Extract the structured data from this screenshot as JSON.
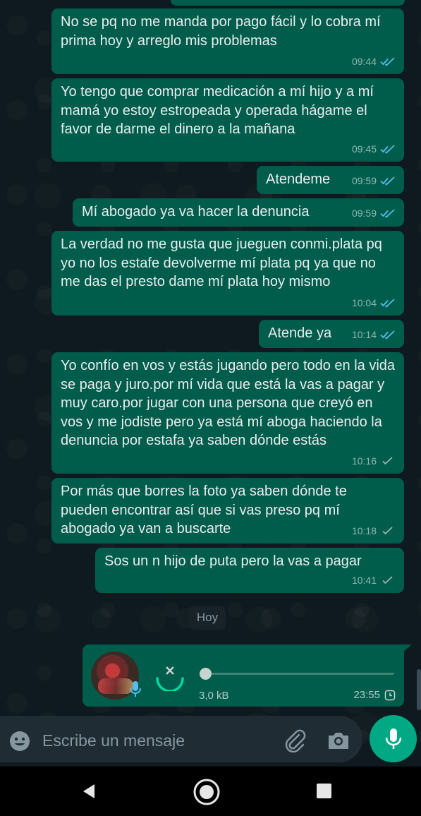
{
  "messages": [
    {
      "text": "No se pq no me manda por pago fácil y lo cobra mí prima hoy y arreglo mis problemas",
      "time": "09:44",
      "status": "read-double-check-blue"
    },
    {
      "text": "Yo tengo que comprar medicación a mí hijo y a mí mamá yo estoy estropeada y operada hágame el favor de darme el dinero a la mañana",
      "time": "09:45",
      "status": "read-double-check-blue"
    },
    {
      "text": "Atendeme",
      "time": "09:59",
      "status": "read-double-check-blue"
    },
    {
      "text": "Mí abogado ya va hacer la denuncia",
      "time": "09:59",
      "status": "read-double-check-blue"
    },
    {
      "text": "La verdad no me gusta que jueguen conmi.plata pq yo no los estafe devolverme mí plata pq ya que no me das el presto dame mí plata hoy mismo",
      "time": "10:04",
      "status": "read-double-check-blue"
    },
    {
      "text": "Atende ya",
      "time": "10:14",
      "status": "read-double-check-blue"
    },
    {
      "text": "Yo confío en vos y estás jugando pero todo en la vida se paga y juro.por mí vida que está la vas a pagar y muy caro.por jugar con una persona que creyó en vos y me jodiste pero ya está mí aboga haciendo la denuncia por estafa ya saben dónde estás",
      "time": "10:16",
      "status": "sent-single-check"
    },
    {
      "text": "Por más que borres la foto ya saben dónde te pueden encontrar así que si vas preso pq mí abogado ya van a buscarte",
      "time": "10:18",
      "status": "sent-single-check"
    },
    {
      "text": "Sos un n hijo de puta pero la vas a pagar",
      "time": "10:41",
      "status": "sent-single-check"
    }
  ],
  "day_separator": "Hoy",
  "voice_note": {
    "size": "3,0 kB",
    "time": "23:55",
    "status": "clock-pending-icon",
    "progress": 0
  },
  "composer": {
    "placeholder": "Escribe un mensaje"
  },
  "colors": {
    "outgoing_bubble": "#005c4b",
    "read_check": "#53bdeb",
    "accent": "#00a884",
    "background": "#0b141a",
    "input_bg": "#1f2c33"
  },
  "icons": [
    "emoji-icon",
    "paperclip-icon",
    "camera-icon",
    "microphone-icon",
    "back-triangle-icon",
    "home-circle-icon",
    "recents-square-icon",
    "cancel-x-icon",
    "clock-icon"
  ]
}
